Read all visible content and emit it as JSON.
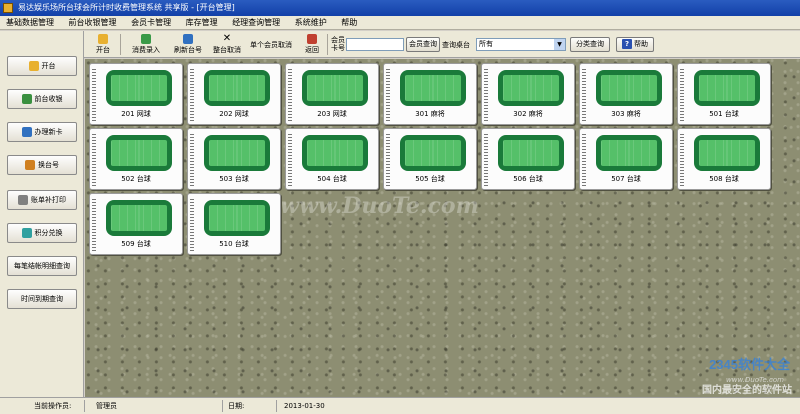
{
  "window": {
    "title": "易达娱乐场所台球会所计时收费管理系统 共享版 - [开台管理]"
  },
  "menu": [
    "基础数据管理",
    "前台收银管理",
    "会员卡管理",
    "库存管理",
    "经理查询管理",
    "系统维护",
    "帮助"
  ],
  "toolbar": {
    "open_label": "开台",
    "consume_label": "消费录入",
    "refresh_label": "刷新台号",
    "cancel_label": "整台取消",
    "member_cancel_label": "单个会员取消",
    "back_label": "返回",
    "card_label_1": "会员",
    "card_label_2": "卡号",
    "card_value": "",
    "card_query_label": "会员查询",
    "table_query_label": "查询桌台",
    "category_value": "所有",
    "category_query_label": "分类查询",
    "help_label": "帮助"
  },
  "sidebar": [
    {
      "label": "开台",
      "icon": "folder-icon",
      "color": "#e8b030"
    },
    {
      "label": "前台收银",
      "icon": "cashier-icon",
      "color": "#3a9040"
    },
    {
      "label": "办理新卡",
      "icon": "card-icon",
      "color": "#3070c0"
    },
    {
      "label": "换台号",
      "icon": "switch-icon",
      "color": "#d08020"
    },
    {
      "label": "账单补打印",
      "icon": "printer-icon",
      "color": "#808080"
    },
    {
      "label": "积分兑换",
      "icon": "points-icon",
      "color": "#30a0a0"
    },
    {
      "label": "每笔结帐明细查询",
      "icon": "",
      "color": ""
    },
    {
      "label": "时间到期查询",
      "icon": "",
      "color": ""
    }
  ],
  "tables": [
    "201 网球",
    "202 网球",
    "203 网球",
    "301 麻将",
    "302 麻将",
    "303 麻将",
    "501 台球",
    "502 台球",
    "503 台球",
    "504 台球",
    "505 台球",
    "506 台球",
    "507 台球",
    "508 台球",
    "509 台球",
    "510 台球"
  ],
  "watermarks": {
    "main": "www.DuoTe.com",
    "logo": "2345软件大全",
    "url": "www.DuoTe.com",
    "tag": "国内最安全的软件站"
  },
  "status": {
    "operator_label": "当前操作员:",
    "operator_value": "管理员",
    "date_label": "日期:",
    "date_value": "2013-01-30"
  }
}
